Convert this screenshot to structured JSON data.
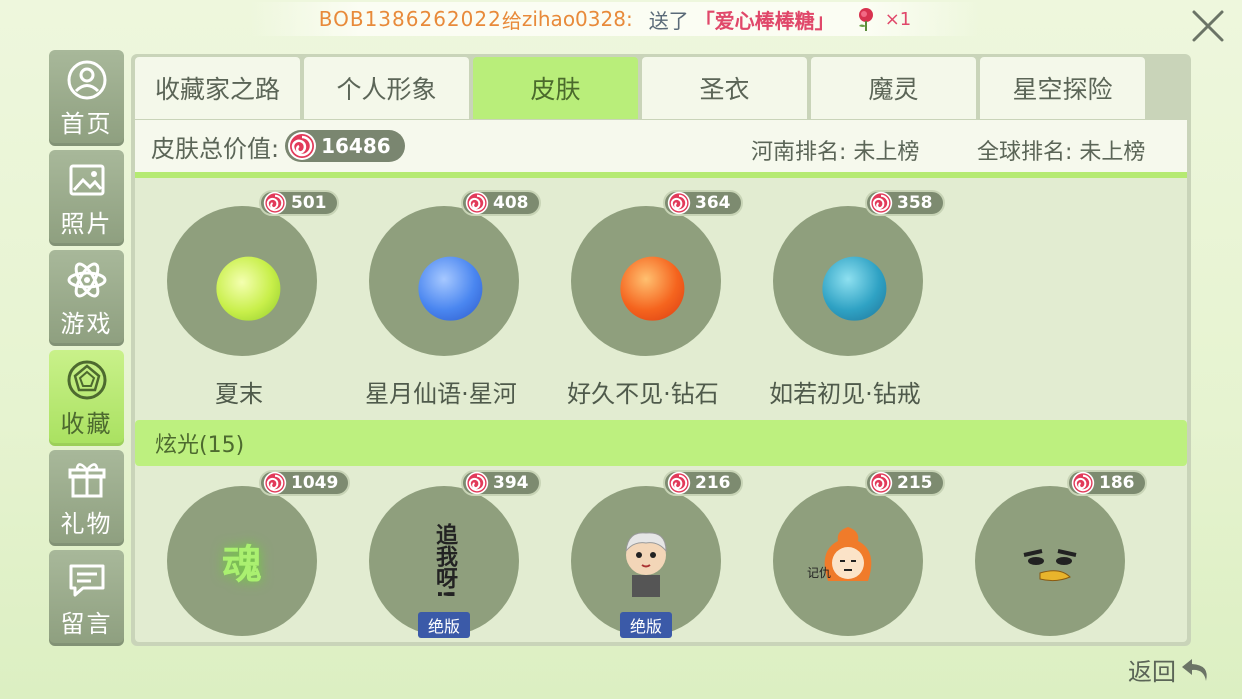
{
  "announcement": {
    "sender": "BOB1386262022",
    "connector": "给",
    "receiver": "zihao0328:",
    "verb": "送了",
    "gift": "「爱心棒棒糖」",
    "gift_icon": "rose-icon",
    "count": "×1"
  },
  "sidebar": {
    "items": [
      {
        "label": "首页",
        "icon": "home-icon"
      },
      {
        "label": "照片",
        "icon": "photo-icon"
      },
      {
        "label": "游戏",
        "icon": "atom-icon"
      },
      {
        "label": "收藏",
        "icon": "gem-icon",
        "active": true
      },
      {
        "label": "礼物",
        "icon": "gift-icon"
      },
      {
        "label": "留言",
        "icon": "message-icon"
      }
    ]
  },
  "tabs": [
    "收藏家之路",
    "个人形象",
    "皮肤",
    "圣衣",
    "魔灵",
    "星空探险"
  ],
  "active_tab": "皮肤",
  "summary": {
    "label": "皮肤总价值:",
    "total": "16486",
    "rank_local": "河南排名: 未上榜",
    "rank_global": "全球排名: 未上榜"
  },
  "skins": [
    {
      "name": "夏末",
      "price": "501",
      "color": "#c8ef4a"
    },
    {
      "name": "星月仙语·星河",
      "price": "408",
      "color": "#4a86f0"
    },
    {
      "name": "好久不见·钻石",
      "price": "364",
      "color": "#f5641e"
    },
    {
      "name": "如若初见·钻戒",
      "price": "358",
      "color": "#2fa2c4"
    }
  ],
  "section": {
    "label": "炫光(15)"
  },
  "effects": [
    {
      "price": "1049",
      "glyph": "魂",
      "limited": ""
    },
    {
      "price": "394",
      "glyph": "追我呀!",
      "limited": "绝版"
    },
    {
      "price": "216",
      "glyph": "",
      "limited": "绝版"
    },
    {
      "price": "215",
      "glyph": "记仇",
      "limited": ""
    },
    {
      "price": "186",
      "glyph": "",
      "limited": ""
    }
  ],
  "close_icon": "close-icon",
  "back_label": "返回",
  "colors": {
    "accent_green": "#b9ee7a",
    "bubble": "#8f9f7d",
    "candy_red": "#e23a5a"
  }
}
